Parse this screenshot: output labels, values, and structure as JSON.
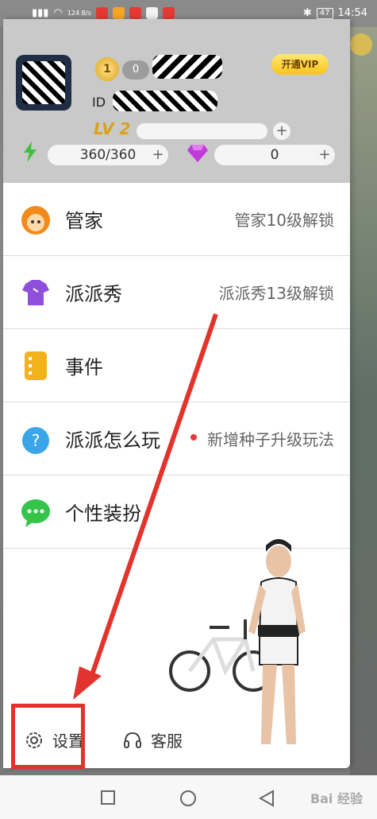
{
  "status_bar": {
    "net_speed": "124\nB/s",
    "time": "14:54",
    "battery": "47",
    "app_icon_colors": [
      "#e53935",
      "#f5a623",
      "#e53935",
      "#f2f2f2",
      "#e53935"
    ]
  },
  "profile": {
    "avatar_icon": "user-avatar-icon",
    "badge_level": "1",
    "badge_count": "0",
    "vip_button": "开通VIP",
    "id_label": "ID",
    "level": "LV 2",
    "energy": "360/360",
    "gems": "0",
    "energy_color": "#3fbf3f",
    "gem_color": "#c23bd9"
  },
  "menu": {
    "items": [
      {
        "label": "管家",
        "hint": "管家10级解锁",
        "icon": "butler-icon",
        "color": "#f28a1b"
      },
      {
        "label": "派派秀",
        "hint": "派派秀13级解锁",
        "icon": "shirt-icon",
        "color": "#8e4fd9"
      },
      {
        "label": "事件",
        "hint": "",
        "icon": "notebook-icon",
        "color": "#f2b21b"
      },
      {
        "label": "派派怎么玩",
        "hint": "新增种子升级玩法",
        "icon": "help-bubble-icon",
        "color": "#3aa6e8"
      },
      {
        "label": "个性装扮",
        "hint": "",
        "icon": "chat-bubble-icon",
        "color": "#35c44a"
      }
    ]
  },
  "bottom": {
    "settings": "设置",
    "service": "客服"
  },
  "nav": {
    "watermark": "Bai 经验"
  },
  "accent": {
    "annotation_red": "#e2332c"
  }
}
